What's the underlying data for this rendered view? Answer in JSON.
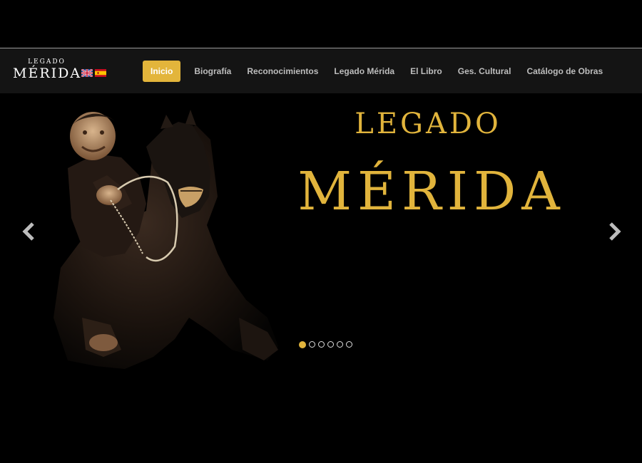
{
  "brand": {
    "top_text": "LEGADO",
    "main_text": "MÉRIDA"
  },
  "languages": [
    {
      "icon": "uk-flag-icon"
    },
    {
      "icon": "spain-flag-icon"
    }
  ],
  "nav": {
    "items": [
      {
        "label": "Inicio",
        "active": true
      },
      {
        "label": "Biografía"
      },
      {
        "label": "Reconocimientos"
      },
      {
        "label": "Legado Mérida"
      },
      {
        "label": "El Libro"
      },
      {
        "label": "Ges. Cultural"
      },
      {
        "label": "Catálogo de Obras"
      }
    ]
  },
  "hero": {
    "title_top": "LEGADO",
    "title_main": "MÉRIDA",
    "prev_icon": "chevron-left-icon",
    "next_icon": "chevron-right-icon",
    "slide_count": 6,
    "active_slide": 1
  },
  "colors": {
    "accent": "#e3b53b",
    "title_gold": "#e1b43c",
    "nav_bg": "#141414",
    "background": "#000000"
  }
}
